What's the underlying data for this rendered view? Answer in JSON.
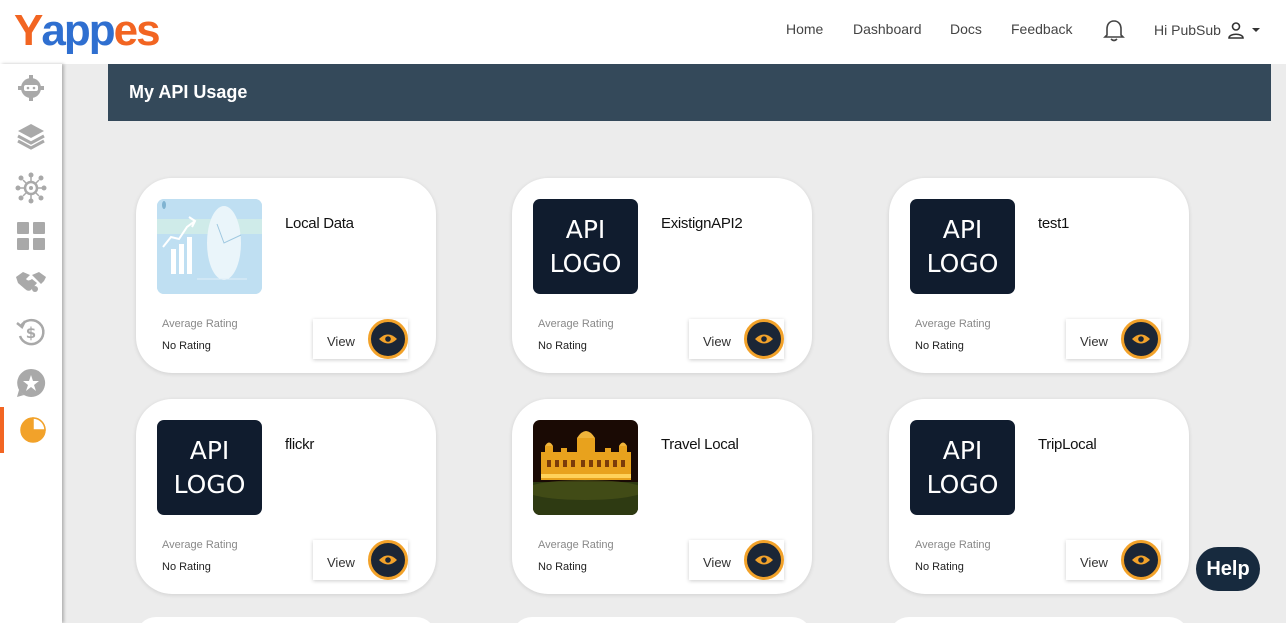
{
  "brand": {
    "logo_text": [
      "Y",
      "a",
      "pp",
      "es"
    ]
  },
  "nav": {
    "home": "Home",
    "dashboard": "Dashboard",
    "docs": "Docs",
    "feedback": "Feedback",
    "user_greeting": "Hi PubSub"
  },
  "page": {
    "title": "My API Usage"
  },
  "card_common": {
    "rating_label": "Average Rating",
    "view_label": "View"
  },
  "cards": [
    {
      "name": "Local Data",
      "rating": "No Rating",
      "image": "chart-illustration"
    },
    {
      "name": "ExistignAPI2",
      "rating": "No Rating",
      "image": "api-logo"
    },
    {
      "name": "test1",
      "rating": "No Rating",
      "image": "api-logo"
    },
    {
      "name": "flickr",
      "rating": "No Rating",
      "image": "api-logo"
    },
    {
      "name": "Travel Local",
      "rating": "No Rating",
      "image": "palace-night-photo"
    },
    {
      "name": "TripLocal",
      "rating": "No Rating",
      "image": "api-logo"
    }
  ],
  "api_logo_text": {
    "line1": "API",
    "line2": "LOGO"
  },
  "help": {
    "label": "Help"
  },
  "sidebar": {
    "items": [
      "settings-icon",
      "layers-icon",
      "network-icon",
      "grid-icon",
      "handshake-icon",
      "billing-icon",
      "star-icon",
      "pie-chart-icon"
    ],
    "active_index": 7
  },
  "colors": {
    "accent": "#f26522",
    "banner": "#34495a",
    "eye": "#f2a22a",
    "logo_bg": "#101c2e"
  }
}
